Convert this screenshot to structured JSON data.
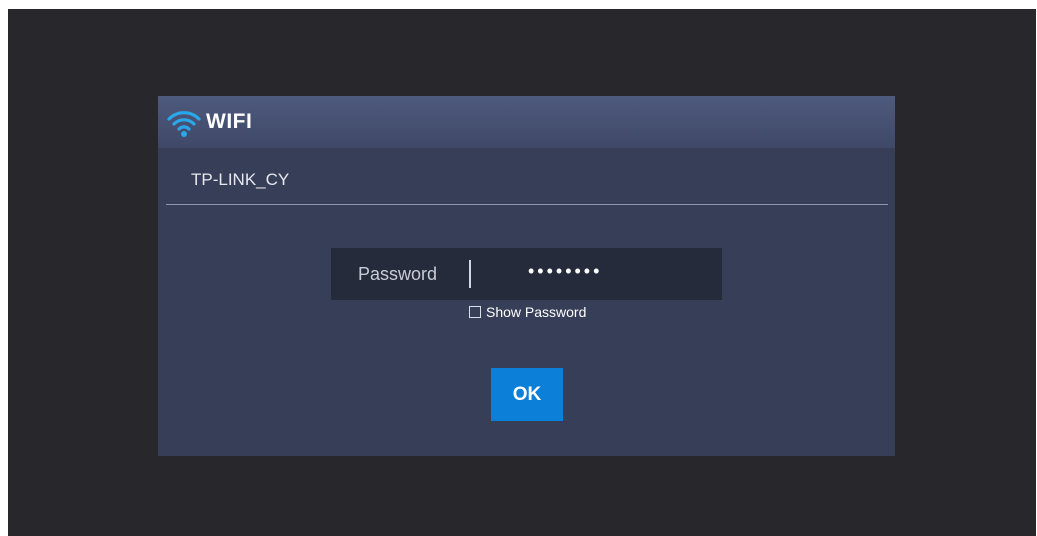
{
  "dialog": {
    "title": "WIFI",
    "title_icon": "wifi-icon",
    "network_name": "TP-LINK_CY"
  },
  "password": {
    "label": "Password",
    "masked_value": "••••••••",
    "show_password_label": "Show Password",
    "show_password_checked": false
  },
  "actions": {
    "ok_label": "OK"
  },
  "colors": {
    "screen_background": "#27272c",
    "dialog_background": "#373e57",
    "title_bar": "#4e5a7e",
    "input_background": "#262b3c",
    "accent": "#0c7fd8",
    "wifi_icon": "#2aa7e8"
  }
}
